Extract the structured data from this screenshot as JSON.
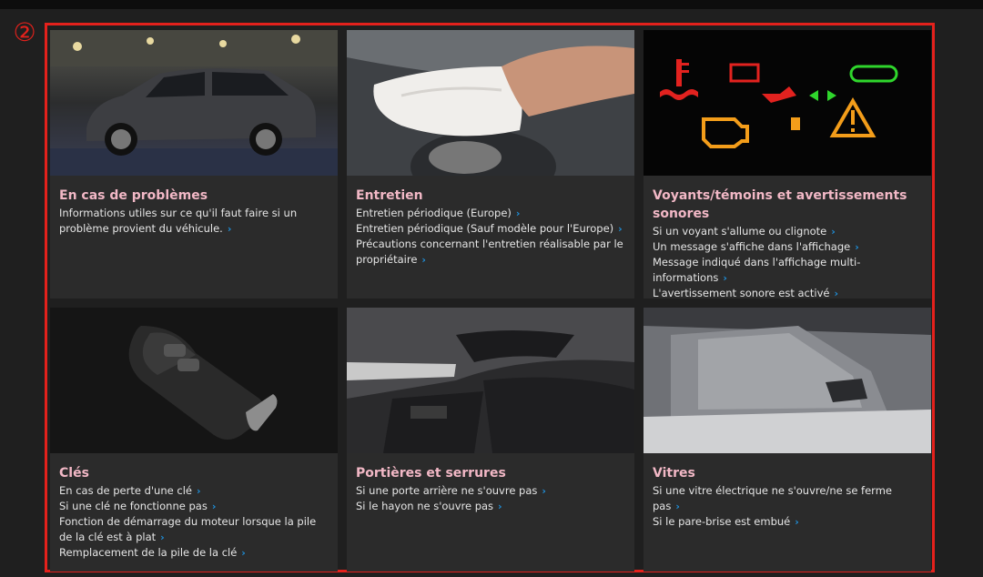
{
  "marker": "②",
  "colors": {
    "accent": "#e4211c",
    "title": "#f2b8c6",
    "chevron": "#1f8fd9",
    "card": "#2b2b2b"
  },
  "cards": [
    {
      "title": "En cas de problèmes",
      "image": "suv-car-photo",
      "links": [
        "Informations utiles sur ce qu'il faut faire si un problème provient du véhicule."
      ]
    },
    {
      "title": "Entretien",
      "image": "cleaning-dashboard-photo",
      "links": [
        "Entretien périodique (Europe)",
        "Entretien périodique (Sauf modèle pour l'Europe)",
        "Précautions concernant l'entretien réalisable par le propriétaire"
      ]
    },
    {
      "title": "Voyants/témoins et avertissements sonores",
      "image": "warning-lights-photo",
      "links": [
        "Si un voyant s'allume ou clignote",
        "Un message s'affiche dans l'affichage",
        "Message indiqué dans l'affichage multi-informations",
        "L'avertissement sonore est activé"
      ]
    },
    {
      "title": "Clés",
      "image": "smart-key-photo",
      "links": [
        "En cas de perte d'une clé",
        "Si une clé ne fonctionne pas",
        "Fonction de démarrage du moteur lorsque la pile de la clé est à plat",
        "Remplacement de la pile de la clé"
      ]
    },
    {
      "title": "Portières et serrures",
      "image": "door-interior-photo",
      "links": [
        "Si une porte arrière ne s'ouvre pas",
        "Si le hayon ne s'ouvre pas"
      ]
    },
    {
      "title": "Vitres",
      "image": "side-window-photo",
      "links": [
        "Si une vitre électrique ne s'ouvre/ne se ferme pas",
        "Si le pare-brise est embué"
      ]
    }
  ]
}
